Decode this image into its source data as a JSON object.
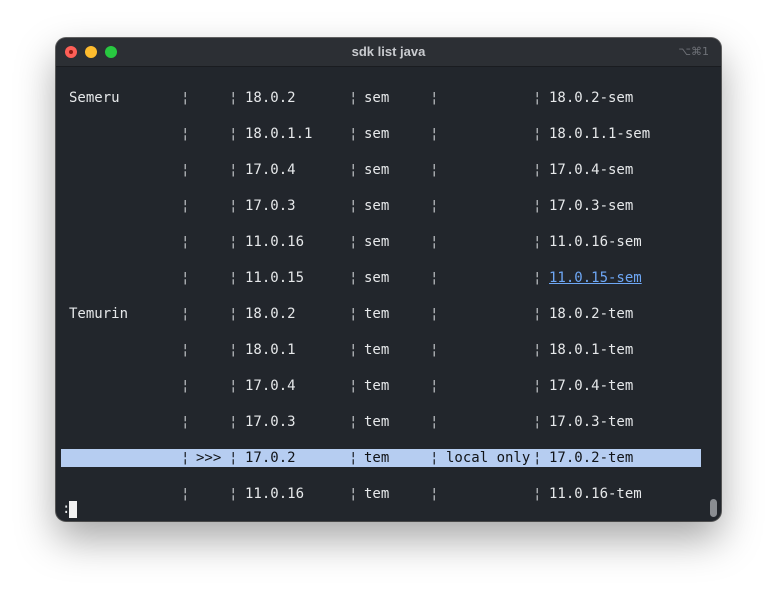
{
  "window": {
    "title": "sdk list java",
    "shortcut": "⌥⌘1"
  },
  "colors": {
    "terminal_bg": "#22262c",
    "selection_bg": "#b6cdf1",
    "link": "#6ea7f5"
  },
  "table": {
    "separator": "¦",
    "rows": [
      {
        "vendor": "Semeru",
        "use": "",
        "version": "18.0.2",
        "dist": "sem",
        "status": "",
        "identifier": "18.0.2-sem"
      },
      {
        "vendor": "",
        "use": "",
        "version": "18.0.1.1",
        "dist": "sem",
        "status": "",
        "identifier": "18.0.1.1-sem"
      },
      {
        "vendor": "",
        "use": "",
        "version": "17.0.4",
        "dist": "sem",
        "status": "",
        "identifier": "17.0.4-sem"
      },
      {
        "vendor": "",
        "use": "",
        "version": "17.0.3",
        "dist": "sem",
        "status": "",
        "identifier": "17.0.3-sem"
      },
      {
        "vendor": "",
        "use": "",
        "version": "11.0.16",
        "dist": "sem",
        "status": "",
        "identifier": "11.0.16-sem"
      },
      {
        "vendor": "",
        "use": "",
        "version": "11.0.15",
        "dist": "sem",
        "status": "",
        "identifier": "11.0.15-sem",
        "link": true
      },
      {
        "vendor": "Temurin",
        "use": "",
        "version": "18.0.2",
        "dist": "tem",
        "status": "",
        "identifier": "18.0.2-tem"
      },
      {
        "vendor": "",
        "use": "",
        "version": "18.0.1",
        "dist": "tem",
        "status": "",
        "identifier": "18.0.1-tem"
      },
      {
        "vendor": "",
        "use": "",
        "version": "17.0.4",
        "dist": "tem",
        "status": "",
        "identifier": "17.0.4-tem"
      },
      {
        "vendor": "",
        "use": "",
        "version": "17.0.3",
        "dist": "tem",
        "status": "",
        "identifier": "17.0.3-tem"
      },
      {
        "vendor": "",
        "use": ">>>",
        "version": "17.0.2",
        "dist": "tem",
        "status": "local only",
        "identifier": "17.0.2-tem",
        "selected": true
      },
      {
        "vendor": "",
        "use": "",
        "version": "11.0.16",
        "dist": "tem",
        "status": "",
        "identifier": "11.0.16-tem"
      }
    ]
  },
  "prompt": ":"
}
